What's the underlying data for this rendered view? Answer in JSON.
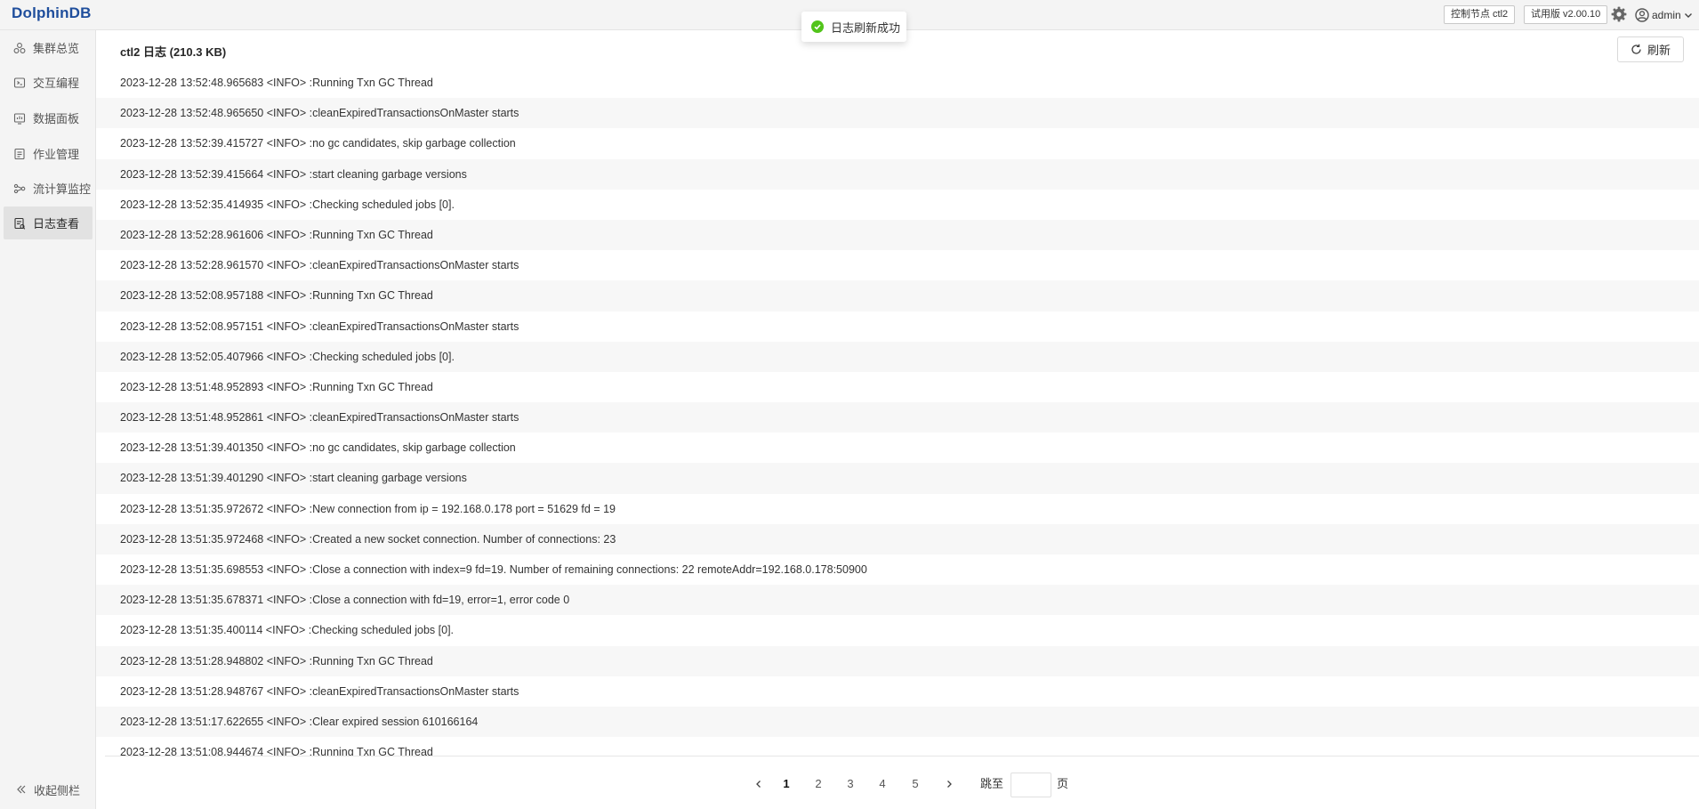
{
  "header": {
    "logo_text": "olphinDB",
    "logo_letter": "D",
    "controller_tag": "控制节点 ctl2",
    "version_tag": "试用版 v2.00.10",
    "user": "admin"
  },
  "toast": {
    "message": "日志刷新成功"
  },
  "sidebar": {
    "items": [
      {
        "label": "集群总览",
        "icon": "cluster-icon"
      },
      {
        "label": "交互编程",
        "icon": "code-icon"
      },
      {
        "label": "数据面板",
        "icon": "dashboard-icon"
      },
      {
        "label": "作业管理",
        "icon": "job-icon"
      },
      {
        "label": "流计算监控",
        "icon": "stream-icon"
      },
      {
        "label": "日志查看",
        "icon": "log-icon",
        "active": true
      }
    ],
    "collapse_label": "收起侧栏"
  },
  "main": {
    "title": "ctl2 日志 (210.3 KB)",
    "refresh_label": "刷新",
    "logs": [
      "2023-12-28 13:52:48.965683 <INFO> :Running Txn GC Thread",
      "2023-12-28 13:52:48.965650 <INFO> :cleanExpiredTransactionsOnMaster starts",
      "2023-12-28 13:52:39.415727 <INFO> :no gc candidates, skip garbage collection",
      "2023-12-28 13:52:39.415664 <INFO> :start cleaning garbage versions",
      "2023-12-28 13:52:35.414935 <INFO> :Checking scheduled jobs [0].",
      "2023-12-28 13:52:28.961606 <INFO> :Running Txn GC Thread",
      "2023-12-28 13:52:28.961570 <INFO> :cleanExpiredTransactionsOnMaster starts",
      "2023-12-28 13:52:08.957188 <INFO> :Running Txn GC Thread",
      "2023-12-28 13:52:08.957151 <INFO> :cleanExpiredTransactionsOnMaster starts",
      "2023-12-28 13:52:05.407966 <INFO> :Checking scheduled jobs [0].",
      "2023-12-28 13:51:48.952893 <INFO> :Running Txn GC Thread",
      "2023-12-28 13:51:48.952861 <INFO> :cleanExpiredTransactionsOnMaster starts",
      "2023-12-28 13:51:39.401350 <INFO> :no gc candidates, skip garbage collection",
      "2023-12-28 13:51:39.401290 <INFO> :start cleaning garbage versions",
      "2023-12-28 13:51:35.972672 <INFO> :New connection from ip = 192.168.0.178 port = 51629 fd = 19",
      "2023-12-28 13:51:35.972468 <INFO> :Created a new socket connection. Number of connections: 23",
      "2023-12-28 13:51:35.698553 <INFO> :Close a connection with index=9 fd=19. Number of remaining connections: 22 remoteAddr=192.168.0.178:50900",
      "2023-12-28 13:51:35.678371 <INFO> :Close a connection with fd=19, error=1, error code 0",
      "2023-12-28 13:51:35.400114 <INFO> :Checking scheduled jobs [0].",
      "2023-12-28 13:51:28.948802 <INFO> :Running Txn GC Thread",
      "2023-12-28 13:51:28.948767 <INFO> :cleanExpiredTransactionsOnMaster starts",
      "2023-12-28 13:51:17.622655 <INFO> :Clear expired session 610166164",
      "2023-12-28 13:51:08.944674 <INFO> :Running Txn GC Thread"
    ]
  },
  "pagination": {
    "pages": [
      "1",
      "2",
      "3",
      "4",
      "5"
    ],
    "current": "1",
    "prev_symbol": "‹",
    "next_symbol": "›",
    "jump_label": "跳至",
    "page_suffix": "页",
    "jump_value": ""
  },
  "colors": {
    "logo": "#1f4e9c",
    "success": "#52c41a",
    "active_nav_bg": "#e2e2e2",
    "stripe": "#f7f7f7"
  }
}
